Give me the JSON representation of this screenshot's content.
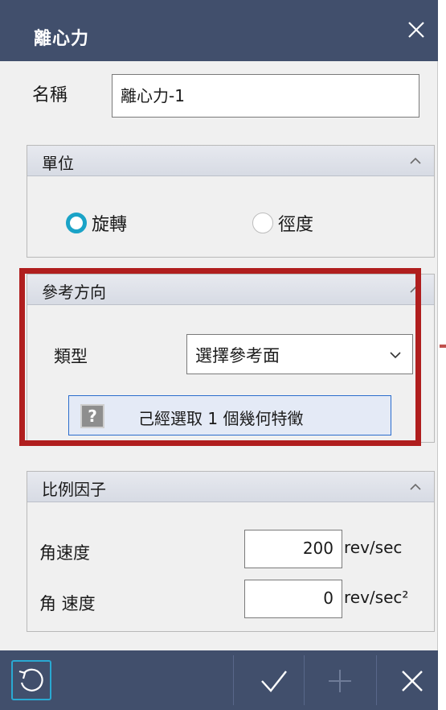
{
  "dialog": {
    "title": "離心力"
  },
  "name": {
    "label": "名稱",
    "value": "離心力-1"
  },
  "unit_group": {
    "title": "單位",
    "options": [
      {
        "label": "旋轉",
        "selected": true
      },
      {
        "label": "徑度",
        "selected": false
      }
    ]
  },
  "ref_group": {
    "title": "參考方向",
    "type_label": "類型",
    "type_value": "選擇參考面",
    "geometry_button": "己經選取 1 個幾何特徵",
    "help_glyph": "?"
  },
  "scale_group": {
    "title": "比例因子",
    "rows": [
      {
        "label": "角速度",
        "value": "200",
        "unit": "rev/sec"
      },
      {
        "label": "角 速度",
        "value": "0",
        "unit": "rev/sec²"
      }
    ]
  },
  "icons": [
    "close-icon",
    "chevron-up-icon",
    "chevron-down-icon",
    "help-icon",
    "reset-icon",
    "check-icon",
    "plus-icon",
    "close-icon"
  ],
  "colors": {
    "titlebar": "#414f6c",
    "accent": "#1aa3c7",
    "highlight": "#b01e1e"
  }
}
